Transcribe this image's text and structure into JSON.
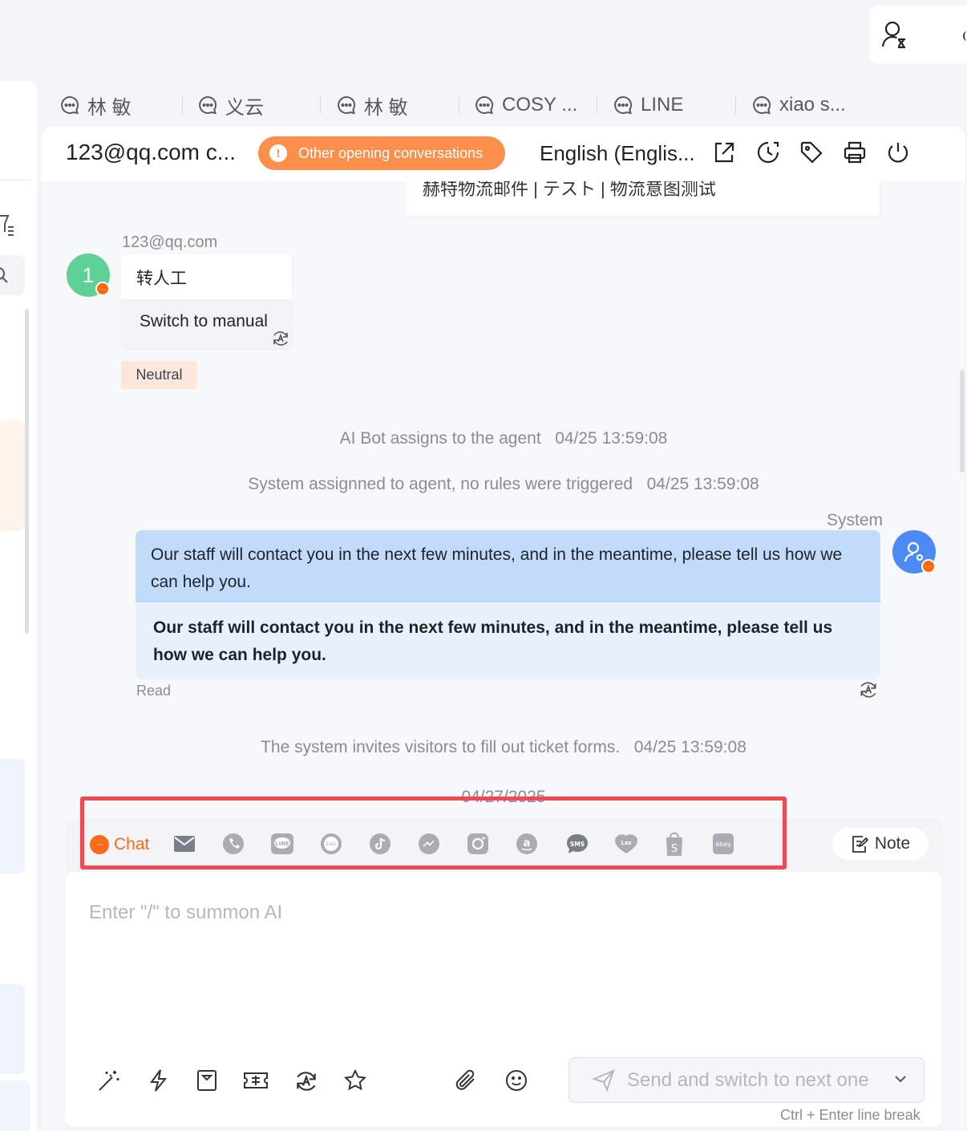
{
  "tabs": [
    {
      "label": "林 敏"
    },
    {
      "label": "义云"
    },
    {
      "label": "林 敏"
    },
    {
      "label": "COSY ..."
    },
    {
      "label": "LINE"
    },
    {
      "label": "xiao s..."
    }
  ],
  "header": {
    "title": "123@qq.com c...",
    "badge": "Other opening conversations",
    "language": "English (Englis..."
  },
  "messages": {
    "cut_text": "赫特物流邮件 | テスト | 物流意图测试",
    "visitor_name": "123@qq.com",
    "visitor_avatar": "1",
    "visitor_original": "转人工",
    "visitor_translation": "Switch to manual",
    "sentiment": "Neutral",
    "sys1_text": "AI Bot assigns to the agent",
    "sys1_time": "04/25 13:59:08",
    "sys2_text": "System assignned to agent, no rules were triggered",
    "sys2_time": "04/25 13:59:08",
    "agent_name": "System",
    "agent_original": "Our staff will contact you in the next few minutes, and in the meantime, please tell us how we can help you.",
    "agent_translation": "Our staff will contact you in the next few minutes, and in the meantime, please tell us how we can help you.",
    "read_status": "Read",
    "sys3_text": "The system invites visitors to fill out ticket forms.",
    "sys3_time": "04/25 13:59:08",
    "date_divider": "04/27/2025"
  },
  "composer": {
    "chat_tab": "Chat",
    "chat_badge": "···",
    "note_label": "Note",
    "placeholder": "Enter \"/\" to summon AI",
    "send_label": "Send and switch to next one",
    "hint": "Ctrl + Enter line break",
    "channels": [
      "email-icon",
      "whatsapp-icon",
      "line-icon",
      "zalo-icon",
      "tiktok-icon",
      "messenger-icon",
      "instagram-icon",
      "amazon-icon",
      "sms-icon",
      "lazada-icon",
      "shopify-icon",
      "ebay-icon"
    ],
    "channel_labels": {
      "line": "LINE",
      "zalo": "Zalo",
      "sms": "SMS",
      "lazada": "Laz",
      "ebay": "ebay"
    }
  },
  "colors": {
    "accent_orange": "#fc6a1c",
    "badge_orange": "#fc8f4c",
    "highlight_red": "#f24a52",
    "agent_bubble": "#c2dbfb",
    "avatar_green": "#5fd197",
    "avatar_blue": "#4c8bf5"
  }
}
